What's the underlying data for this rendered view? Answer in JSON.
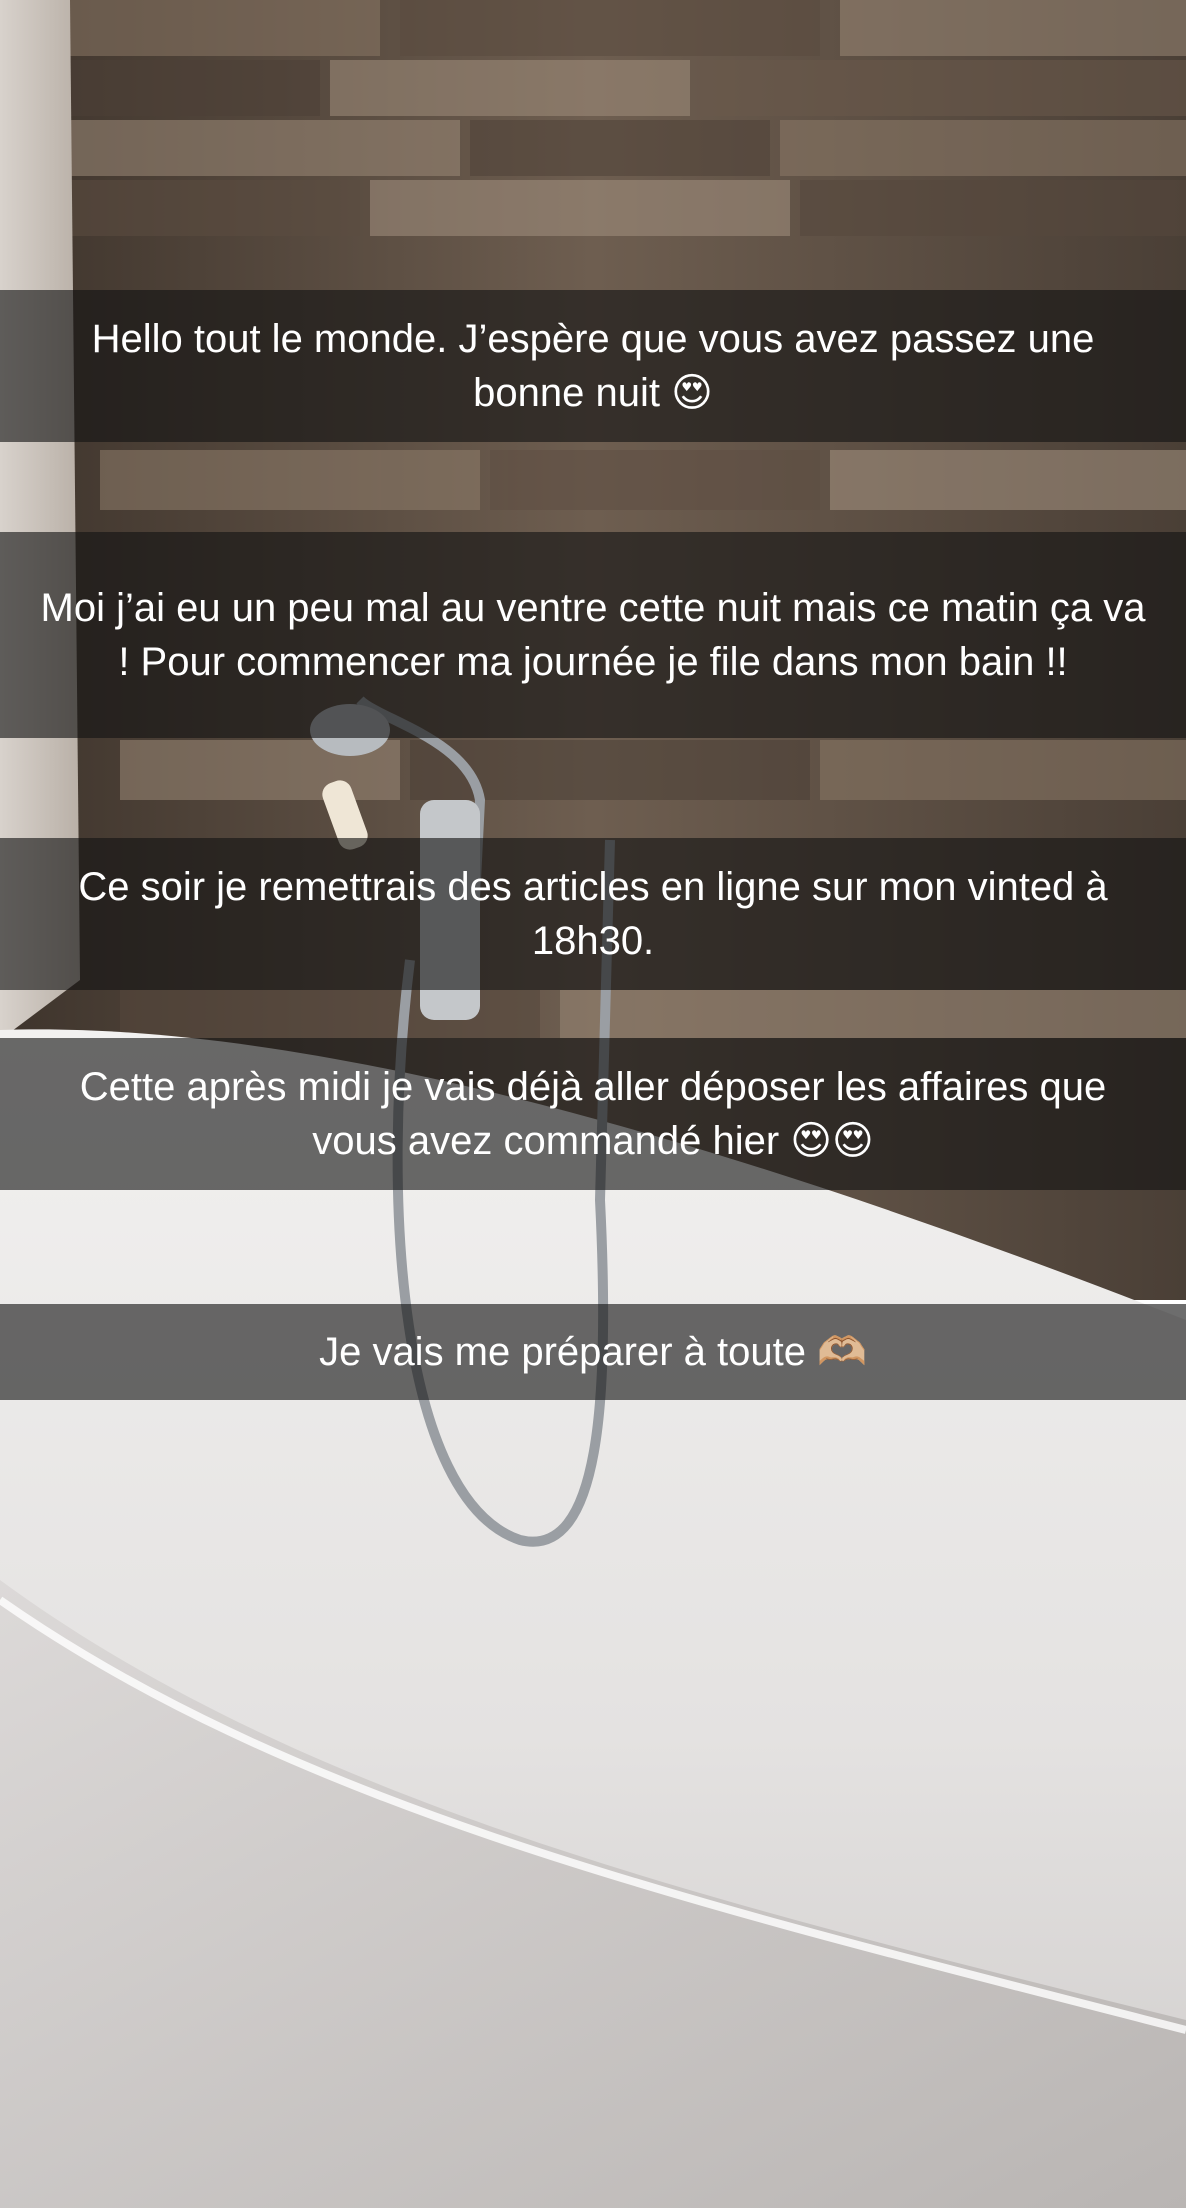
{
  "story": {
    "captions": [
      "Hello tout le monde. J’espère que vous avez passez une bonne nuit 😍",
      "Moi j’ai eu un peu mal au ventre cette nuit mais ce matin ça va ! Pour commencer ma journée je file dans mon bain !!",
      "Ce soir je remettrais des articles en ligne sur mon vinted à 18h30.",
      "Cette après midi je vais déjà aller déposer les affaires que vous avez commandé hier 😍😍",
      "Je vais me préparer à toute 🫶🏼"
    ]
  },
  "colors": {
    "caption_bg": "#141414",
    "caption_text": "#ffffff",
    "tub": "#e9e7e6",
    "wall_wood": "#6b5a4c"
  }
}
